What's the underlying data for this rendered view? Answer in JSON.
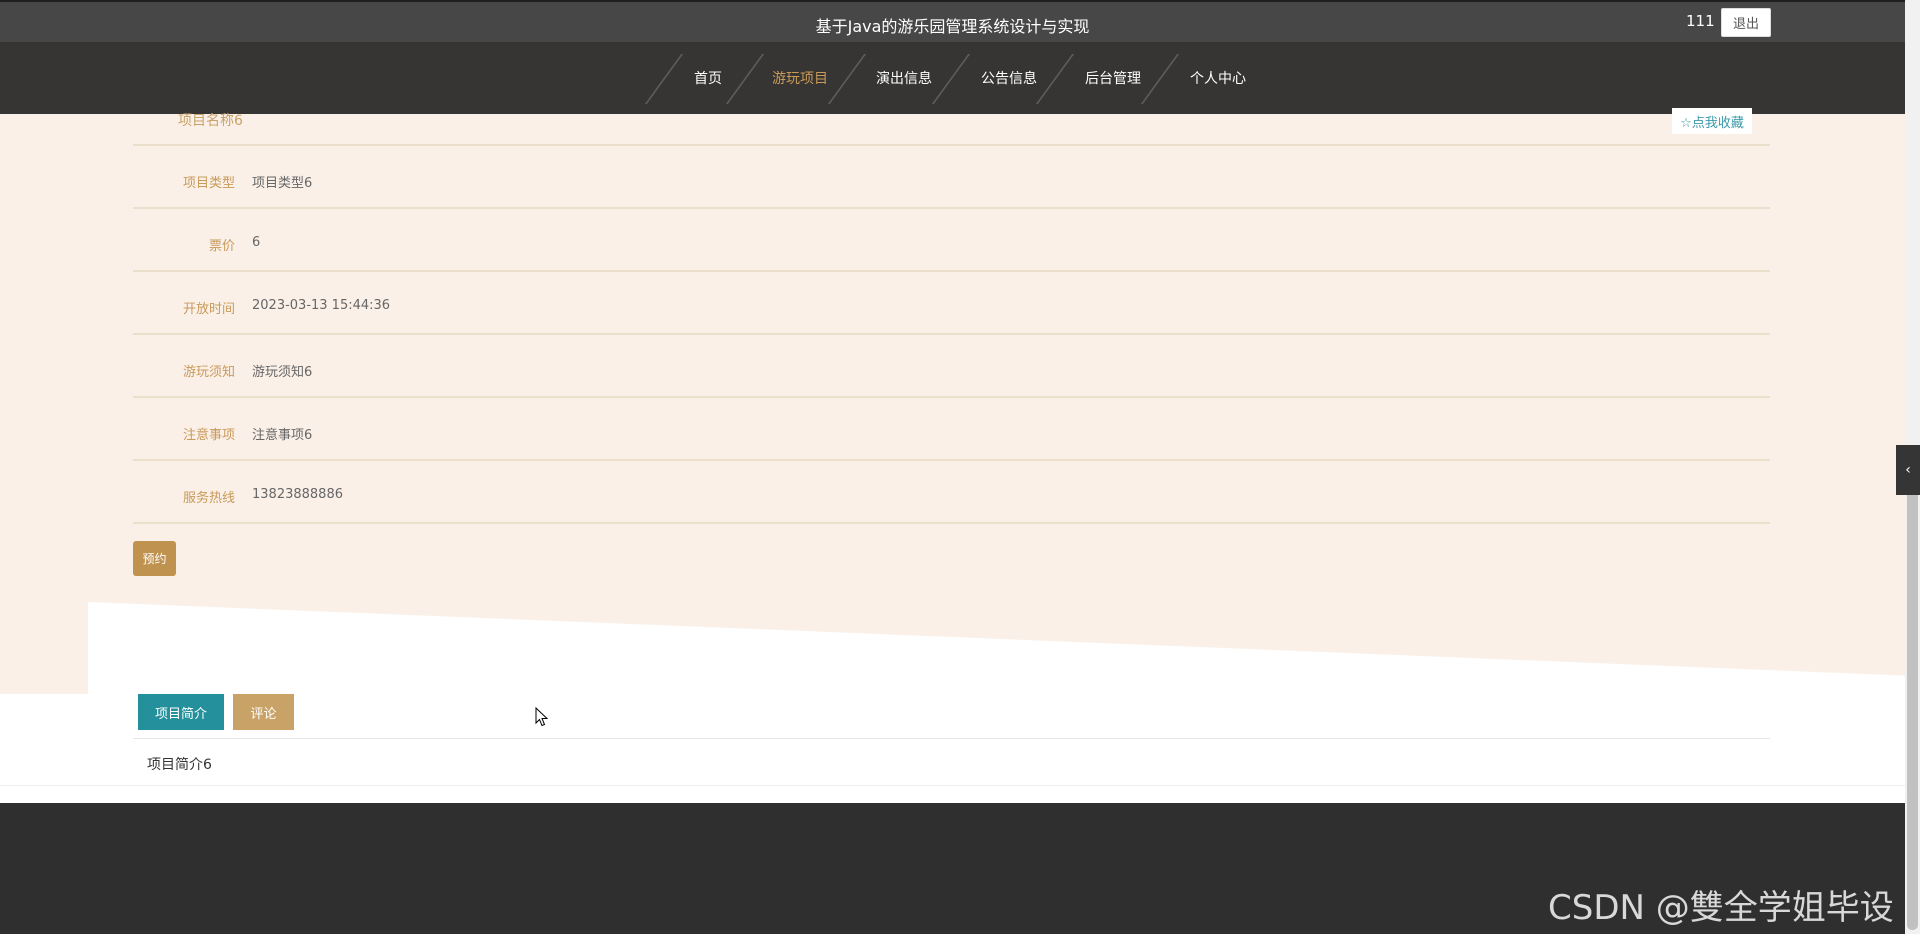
{
  "header": {
    "title": "基于Java的游乐园管理系统设计与实现",
    "user": "111",
    "logout_label": "退出"
  },
  "nav": {
    "items": [
      {
        "label": "首页",
        "active": false
      },
      {
        "label": "游玩项目",
        "active": true
      },
      {
        "label": "演出信息",
        "active": false
      },
      {
        "label": "公告信息",
        "active": false
      },
      {
        "label": "后台管理",
        "active": false
      },
      {
        "label": "个人中心",
        "active": false
      }
    ]
  },
  "detail": {
    "project_name": "项目名称6",
    "favorite_label": "☆点我收藏",
    "fields": [
      {
        "label": "项目类型",
        "value": "项目类型6"
      },
      {
        "label": "票价",
        "value": "6"
      },
      {
        "label": "开放时间",
        "value": "2023-03-13 15:44:36"
      },
      {
        "label": "游玩须知",
        "value": "游玩须知6"
      },
      {
        "label": "注意事项",
        "value": "注意事项6"
      },
      {
        "label": "服务热线",
        "value": "13823888886"
      }
    ],
    "reserve_label": "预约"
  },
  "tabs": {
    "intro_label": "项目简介",
    "comment_label": "评论",
    "intro_content": "项目简介6"
  },
  "watermark": "CSDN @雙全学姐毕设",
  "colors": {
    "accent": "#c99a5a",
    "teal": "#23909b",
    "detail_bg": "#faf0e8",
    "nav_bg": "#363534"
  }
}
